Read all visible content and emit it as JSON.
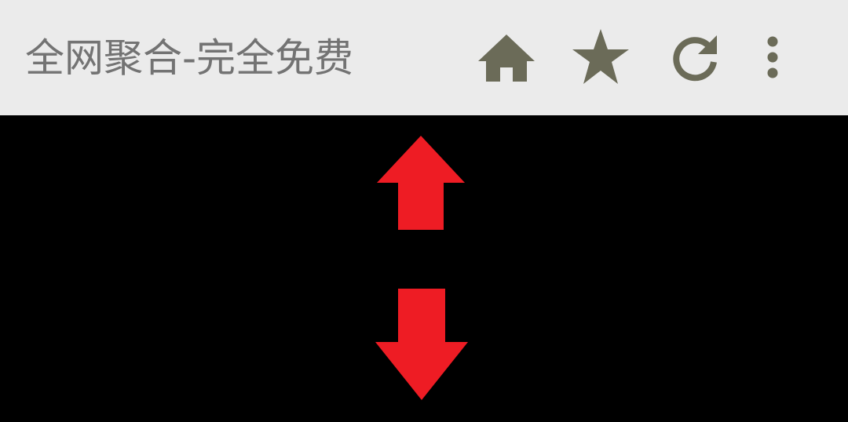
{
  "toolbar": {
    "title": "全网聚合-完全免费",
    "actions": [
      {
        "icon": "home-icon"
      },
      {
        "icon": "star-icon"
      },
      {
        "icon": "refresh-icon"
      },
      {
        "icon": "more-vert-icon"
      }
    ],
    "icon_color": "#6b6b58",
    "background": "#ebebeb"
  },
  "content": {
    "background": "#000000",
    "arrow_color": "#ee1c24",
    "arrows": [
      {
        "icon": "arrow-up-icon"
      },
      {
        "icon": "arrow-down-icon"
      }
    ]
  }
}
